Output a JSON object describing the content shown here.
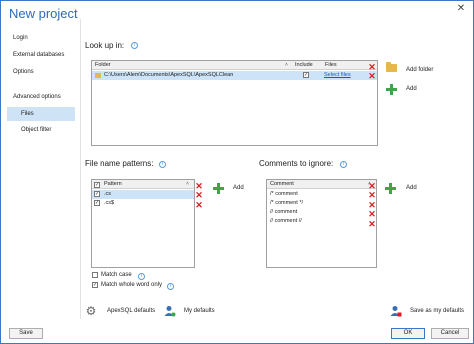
{
  "window": {
    "title": "New project",
    "close_glyph": "✕"
  },
  "sidebar": {
    "items": [
      {
        "label": "Login"
      },
      {
        "label": "External databases"
      },
      {
        "label": "Options"
      },
      {
        "label": "Advanced options"
      },
      {
        "label": "Files",
        "selected": true
      },
      {
        "label": "Object filter"
      }
    ]
  },
  "look_up_in": {
    "label": "Look up in:",
    "columns": [
      "Folder",
      "Include",
      "Files"
    ],
    "rows": [
      {
        "folder": "C:\\Users\\Alem\\Documents\\ApexSQL\\ApexSQLClean",
        "include": true,
        "files_link": "Select files"
      }
    ],
    "add_folder_label": "Add folder",
    "add_label": "Add"
  },
  "file_name_patterns": {
    "label": "File name patterns:",
    "column": "Pattern",
    "rows": [
      {
        "value": ".cs",
        "checked": true
      },
      {
        "value": ".cs$",
        "checked": true
      }
    ],
    "add_label": "Add",
    "match_case_label": "Match case",
    "match_whole_word_label": "Match whole word only",
    "match_case_checked": false,
    "match_whole_word_checked": true
  },
  "comments_to_ignore": {
    "label": "Comments to ignore:",
    "column": "Comment",
    "rows": [
      "/* comment",
      "/* comment */",
      "// comment",
      "// comment //"
    ],
    "add_label": "Add"
  },
  "footer": {
    "apexsql_defaults_label": "ApexSQL defaults",
    "my_defaults_label": "My defaults",
    "save_as_my_defaults_label": "Save as my defaults",
    "save_button": "Save",
    "ok_button": "OK",
    "cancel_button": "Cancel"
  },
  "colors": {
    "accent": "#2d6bb8",
    "selection": "#cfe3f7",
    "delete_red": "#d62020",
    "add_green": "#3aa84a",
    "folder_yellow": "#e8b64a"
  }
}
